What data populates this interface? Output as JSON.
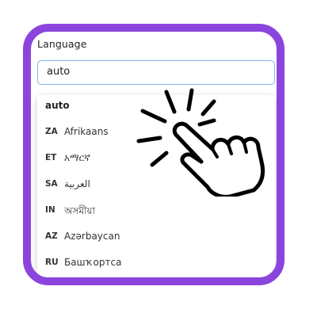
{
  "language": {
    "label": "Language",
    "selected_value": "auto"
  },
  "dropdown": {
    "options": [
      {
        "code": "",
        "name": "auto",
        "selected": true
      },
      {
        "code": "ZA",
        "name": "Afrikaans"
      },
      {
        "code": "ET",
        "name": "አማርኛ"
      },
      {
        "code": "SA",
        "name": "العربية"
      },
      {
        "code": "IN",
        "name": "অসমীয়া"
      },
      {
        "code": "AZ",
        "name": "Azərbaycan"
      },
      {
        "code": "RU",
        "name": "Башҡортса"
      }
    ]
  },
  "colors": {
    "frame": "#8b45dd",
    "select_border": "#7fb2e6"
  },
  "overlay_icon": "pointing-hand-click-icon"
}
